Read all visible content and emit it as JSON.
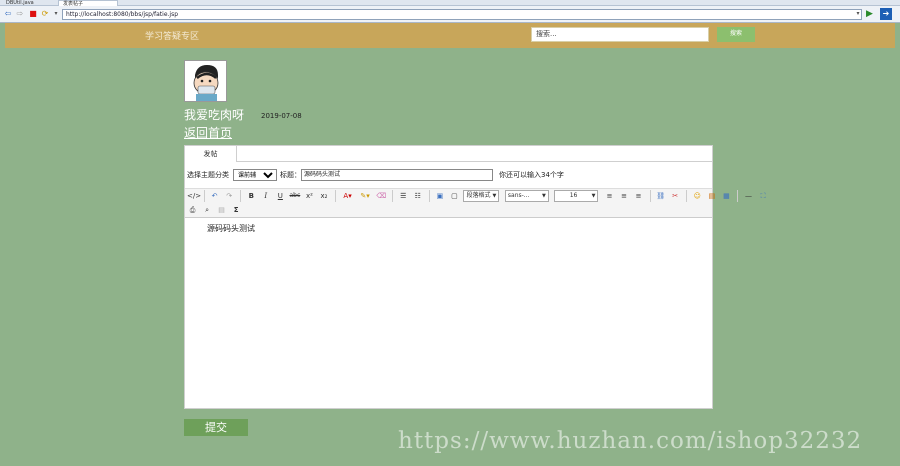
{
  "browser": {
    "tabs": [
      {
        "label": "DBUtil.java"
      },
      {
        "label": "发表帖子"
      }
    ],
    "address": "http://localhost:8080/bbs/jsp/fatie.jsp"
  },
  "header": {
    "site_title": "学习答疑专区",
    "search_placeholder": "搜索...",
    "search_button": "搜索"
  },
  "profile": {
    "username": "我爱吃肉呀",
    "date": "2019-07-08",
    "back_link": "返回首页"
  },
  "post_form": {
    "tab_label": "发帖",
    "category_label": "选择主题分类",
    "category_value": "课前辅",
    "title_label": "标题：",
    "title_value": "源码码头测试",
    "hint": "你还可以输入34个字"
  },
  "toolbar": {
    "paragraph_format": "段落格式",
    "font_family": "sans-...",
    "font_size": "16"
  },
  "editor": {
    "content": "源码码头测试"
  },
  "submit_label": "提交",
  "watermark": "https://www.huzhan.com/ishop32232",
  "colors": {
    "background": "#8fb28a",
    "header": "#c8a65a",
    "search_button": "#8cbf6e",
    "submit_button": "#6ea05a"
  }
}
